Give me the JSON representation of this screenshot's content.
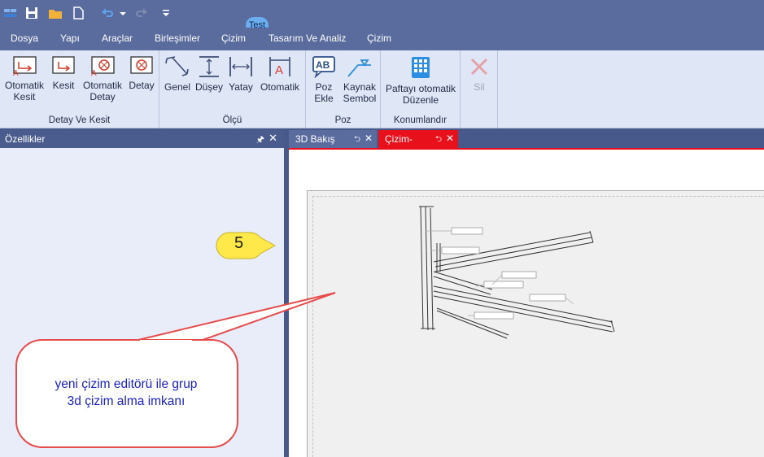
{
  "quick_access": {
    "icons": [
      "ribbon-menu-icon",
      "save-icon",
      "open-folder-icon",
      "new-file-icon",
      "undo-icon",
      "undo-dropdown-icon",
      "redo-icon",
      "customize-dropdown-icon"
    ]
  },
  "contextual_tab": {
    "label": "Test"
  },
  "menu_tabs": [
    "Dosya",
    "Yapı",
    "Araçlar",
    "Birleşimler",
    "Çizim",
    "Tasarım Ve Analiz",
    "Çizim"
  ],
  "ribbon": {
    "groups": [
      {
        "label": "Detay Ve Kesit",
        "buttons": [
          {
            "line1": "Otomatik",
            "line2": "Kesit"
          },
          {
            "line1": "Kesit",
            "line2": ""
          },
          {
            "line1": "Otomatik",
            "line2": "Detay"
          },
          {
            "line1": "Detay",
            "line2": ""
          }
        ]
      },
      {
        "label": "Ölçü",
        "buttons": [
          {
            "line1": "Genel",
            "line2": ""
          },
          {
            "line1": "Düşey",
            "line2": ""
          },
          {
            "line1": "Yatay",
            "line2": ""
          },
          {
            "line1": "Otomatik",
            "line2": ""
          }
        ]
      },
      {
        "label": "Poz",
        "buttons": [
          {
            "line1": "Poz",
            "line2": "Ekle",
            "icon_text": "AB"
          },
          {
            "line1": "Kaynak",
            "line2": "Sembol"
          }
        ]
      },
      {
        "label": "Konumlandır",
        "buttons": [
          {
            "line1": "Paftayı otomatik",
            "line2": "Düzenle"
          }
        ]
      },
      {
        "label": "",
        "buttons": [
          {
            "line1": "Sil",
            "line2": ""
          }
        ]
      }
    ]
  },
  "left_panel": {
    "title": "Özellikler"
  },
  "doc_tabs": [
    {
      "label": "3D Bakış"
    },
    {
      "label": "Çizim-"
    }
  ],
  "callout": {
    "number": "5",
    "text_line1": "yeni çizim editörü ile grup",
    "text_line2": "3d çizim alma imkanı"
  },
  "colors": {
    "title_bar": "#5a6c9e",
    "ribbon_bg": "#dfe6f6",
    "panel_bg": "#e9edfa",
    "active_tab": "#e8101a",
    "callout_border": "#e74c4c",
    "badge_fill": "#ffe94a",
    "callout_text": "#1c22c8"
  }
}
